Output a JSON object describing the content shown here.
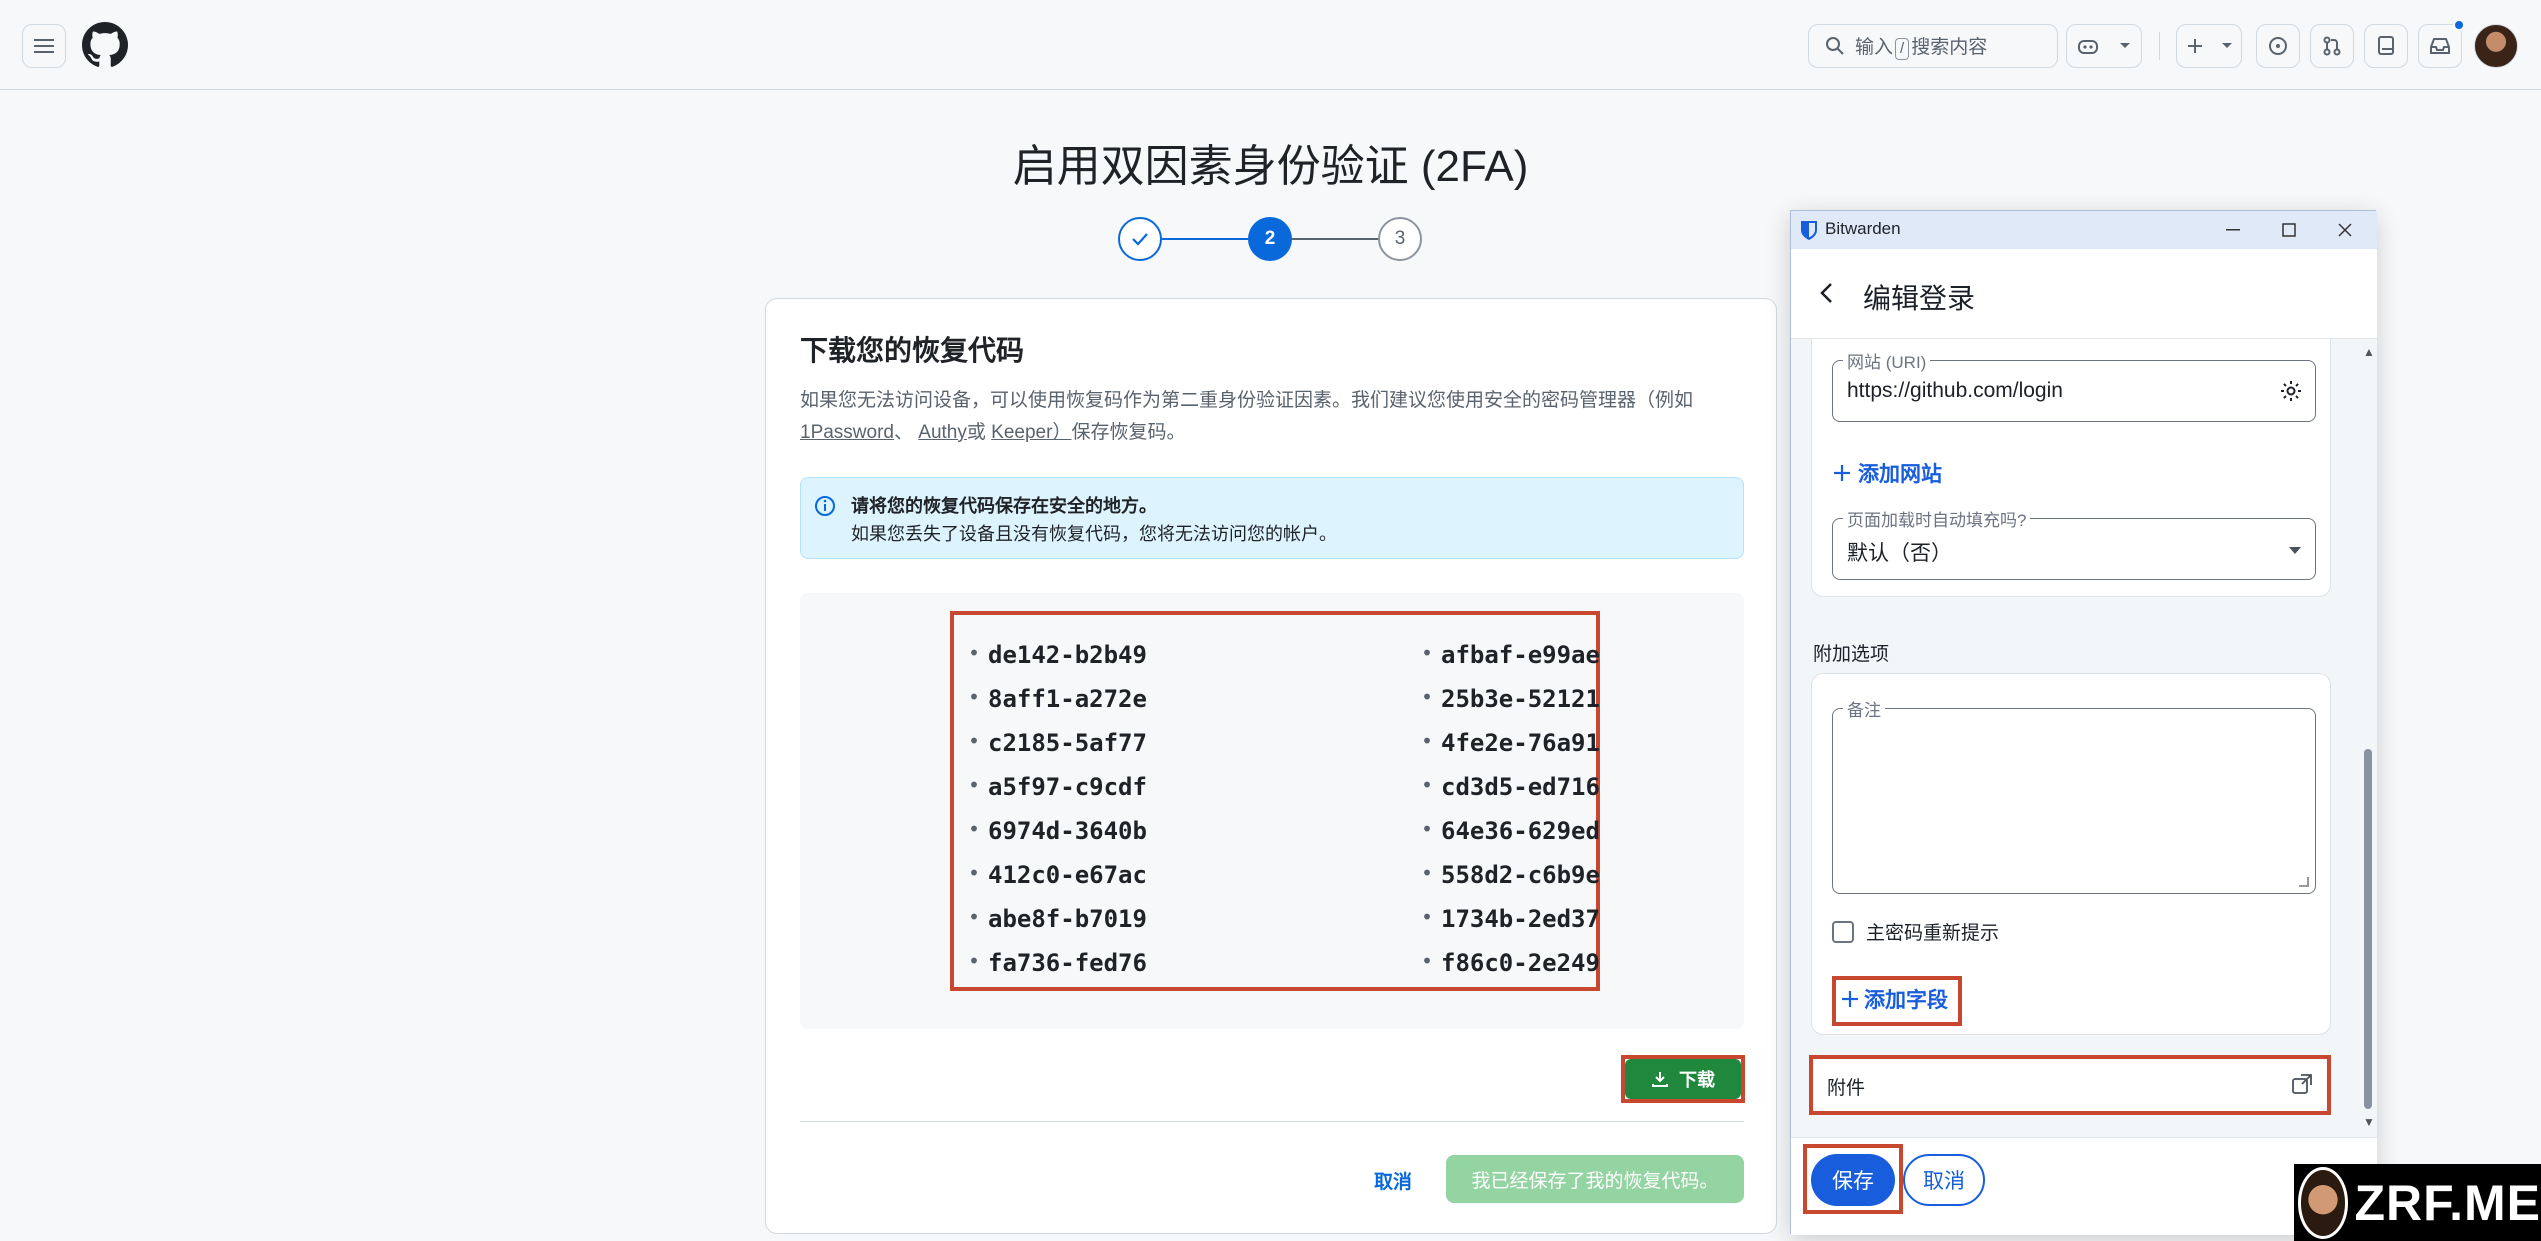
{
  "header": {
    "search_placeholder_pre": "输入",
    "search_kbd": "/",
    "search_placeholder_post": "搜索内容"
  },
  "page": {
    "title": "启用双因素身份验证 (2FA)",
    "steps": [
      {
        "label": "✓",
        "state": "done"
      },
      {
        "label": "2",
        "state": "active"
      },
      {
        "label": "3",
        "state": "pending"
      }
    ]
  },
  "card": {
    "title": "下载您的恢复代码",
    "desc_part1": "如果您无法访问设备，可以使用恢复码作为第二重身份验证因素。我们建议您使用安全的密码管理器（例如",
    "link_1password": "1Password",
    "sep1": "、 ",
    "link_authy": "Authy",
    "sep2": "或 ",
    "link_keeper": "Keeper）",
    "desc_part2": "保存恢复码。",
    "flash_title": "请将您的恢复代码保存在安全的地方。",
    "flash_body": "如果您丢失了设备且没有恢复代码，您将无法访问您的帐户。",
    "codes_left": [
      "de142-b2b49",
      "8aff1-a272e",
      "c2185-5af77",
      "a5f97-c9cdf",
      "6974d-3640b",
      "412c0-e67ac",
      "abe8f-b7019",
      "fa736-fed76"
    ],
    "codes_right": [
      "afbaf-e99ae",
      "25b3e-52121",
      "4fe2e-76a91",
      "cd3d5-ed716",
      "64e36-629ed",
      "558d2-c6b9e",
      "1734b-2ed37",
      "f86c0-2e249"
    ],
    "download_label": "下载",
    "cancel_label": "取消",
    "saved_label": "我已经保存了我的恢复代码。"
  },
  "bitwarden": {
    "app_title": "Bitwarden",
    "nav_title": "编辑登录",
    "uri_label": "网站 (URI)",
    "uri_value": "https://github.com/login",
    "add_site": "添加网站",
    "autofill_label": "页面加载时自动填充吗?",
    "autofill_value": "默认（否）",
    "extra_options": "附加选项",
    "notes_label": "备注",
    "reprompt_label": "主密码重新提示",
    "add_field": "添加字段",
    "attachments": "附件",
    "save": "保存",
    "cancel": "取消"
  },
  "watermark": {
    "text": "ZRF.ME"
  },
  "colors": {
    "accent": "#0969da",
    "primary_green": "#1f883d",
    "bitwarden_blue": "#175ddc",
    "highlight_red": "#c8472f"
  }
}
